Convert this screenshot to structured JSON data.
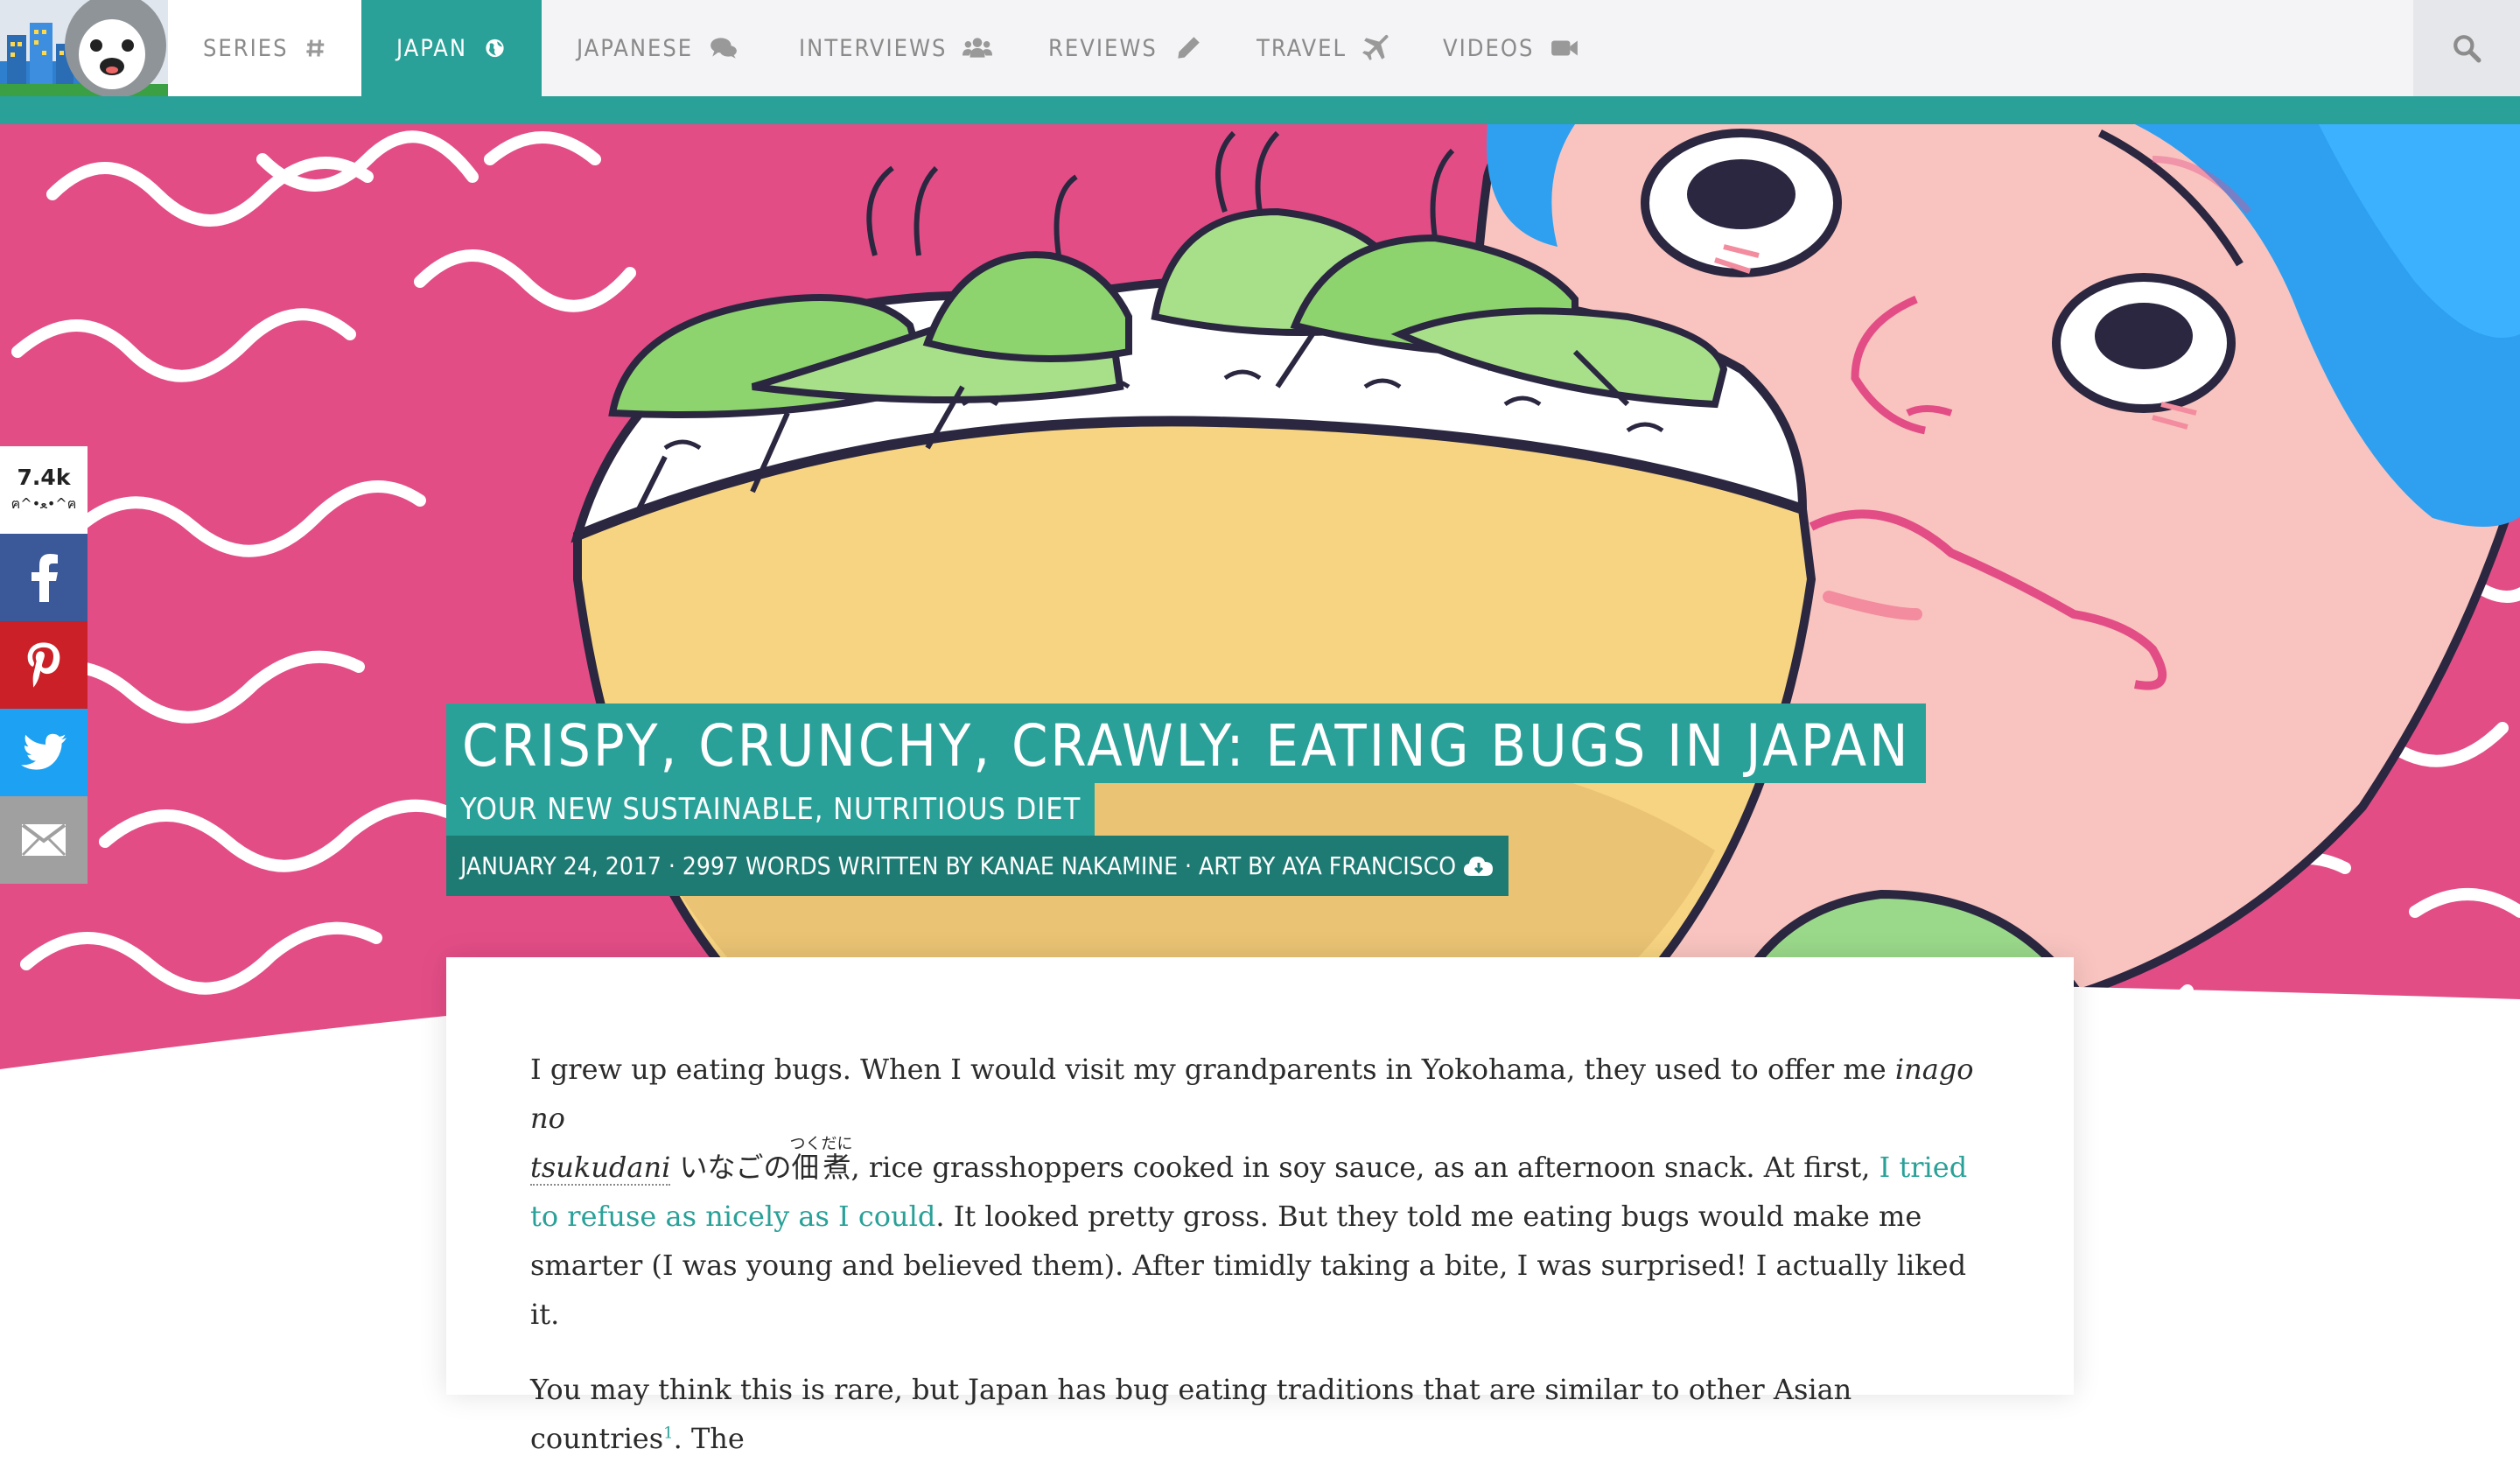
{
  "nav": {
    "items": [
      {
        "label": "SERIES",
        "icon": "hash-icon"
      },
      {
        "label": "JAPAN",
        "icon": "globe-icon"
      },
      {
        "label": "JAPANESE",
        "icon": "comments-icon"
      },
      {
        "label": "INTERVIEWS",
        "icon": "users-icon"
      },
      {
        "label": "REVIEWS",
        "icon": "pencil-icon"
      },
      {
        "label": "TRAVEL",
        "icon": "plane-icon"
      },
      {
        "label": "VIDEOS",
        "icon": "video-camera-icon"
      }
    ],
    "active": "JAPAN",
    "search_icon": "search-icon"
  },
  "share": {
    "count": "7.4k",
    "kaomoji": "ฅ^•ﻌ•^ฅ",
    "buttons": [
      {
        "name": "facebook",
        "icon": "facebook-icon",
        "color": "#3b5998"
      },
      {
        "name": "pinterest",
        "icon": "pinterest-icon",
        "color": "#cb2027"
      },
      {
        "name": "twitter",
        "icon": "twitter-icon",
        "color": "#1da1f2"
      },
      {
        "name": "email",
        "icon": "email-icon",
        "color": "#a0a0a0"
      }
    ]
  },
  "article": {
    "title": "CRISPY, CRUNCHY, CRAWLY: EATING BUGS IN JAPAN",
    "subtitle": "YOUR NEW SUSTAINABLE, NUTRITIOUS DIET",
    "meta": "JANUARY 24, 2017 · 2997 WORDS WRITTEN BY KANAE NAKAMINE · ART BY AYA FRANCISCO",
    "meta_icon": "cloud-download-icon",
    "p1": {
      "t1": "I grew up eating bugs. When I would visit my grandparents in Yokohama, they used to offer me ",
      "italic": "inago no",
      "italic2": "tsukudani",
      "kana": " いなごの",
      "kanji": "佃煮",
      "ruby": "つくだに",
      "t2": ", rice grasshoppers cooked in soy sauce, as an afternoon snack. At first, ",
      "link": "I tried to refuse as nicely as I could",
      "t3": ". It looked pretty gross. But they told me eating bugs would make me smarter (I was young and believed them). After timidly taking a bite, I was surprised! I actually liked it."
    },
    "p2": {
      "t1": "You may think this is rare, but Japan has bug eating traditions that are similar to other Asian countries",
      "sup": "1",
      "t2": ". The"
    }
  },
  "colors": {
    "accent": "#2aa198",
    "accent_dark": "#1e7b74",
    "hero_pink": "#e34d86",
    "nav_bg": "#f4f4f6"
  }
}
